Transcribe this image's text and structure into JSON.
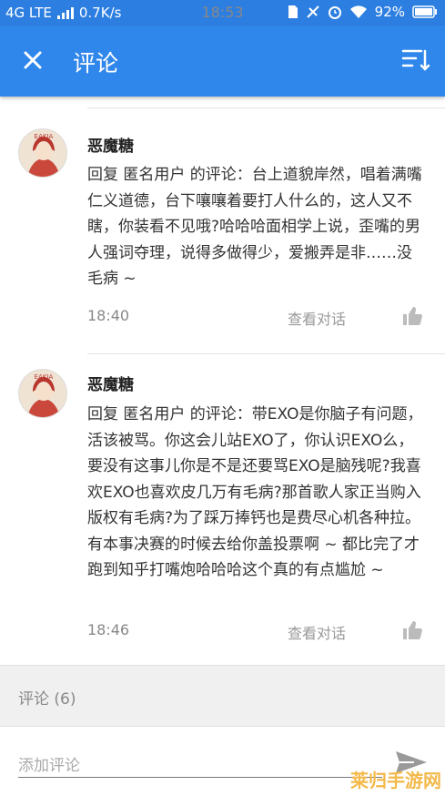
{
  "status_bar": {
    "network": "4G LTE",
    "speed": "0.7K/s",
    "time": "18:53",
    "battery": "92%"
  },
  "app_bar": {
    "title": "评论",
    "close_icon": "close-icon",
    "sort_icon": "sort-icon"
  },
  "comments": [
    {
      "author": "恶魔糖",
      "text": "回复 匿名用户 的评论：台上道貌岸然，唱着满嘴仁义道德，台下嚷嚷着要打人什么的，这人又不瞎，你装看不见哦?哈哈哈面相学上说，歪嘴的男人强词夺理，说得多做得少，爱搬弄是非……没毛病 ~",
      "time": "18:40",
      "view_conversation": "查看对话",
      "like_icon": "thumbs-up-icon"
    },
    {
      "author": "恶魔糖",
      "text": "回复 匿名用户 的评论：带EXO是你脑子有问题，活该被骂。你这会儿站EXO了，你认识EXO么，要没有这事儿你是不是还要骂EXO是脑残呢?我喜欢EXO也喜欢皮几万有毛病?那首歌人家正当购入版权有毛病?为了踩万捧钙也是费尽心机各种拉。有本事决赛的时候去给你盖投票啊 ~ 都比完了才跑到知乎打嘴炮哈哈哈这个真的有点尴尬 ~",
      "time": "18:46",
      "view_conversation": "查看对话",
      "like_icon": "thumbs-up-icon"
    }
  ],
  "comment_count_label": "评论 (6)",
  "add_comment_placeholder": "添加评论",
  "watermark": "莱归手游网",
  "colors": {
    "primary": "#2f86eb",
    "status_bar": "#2c7ee0"
  }
}
